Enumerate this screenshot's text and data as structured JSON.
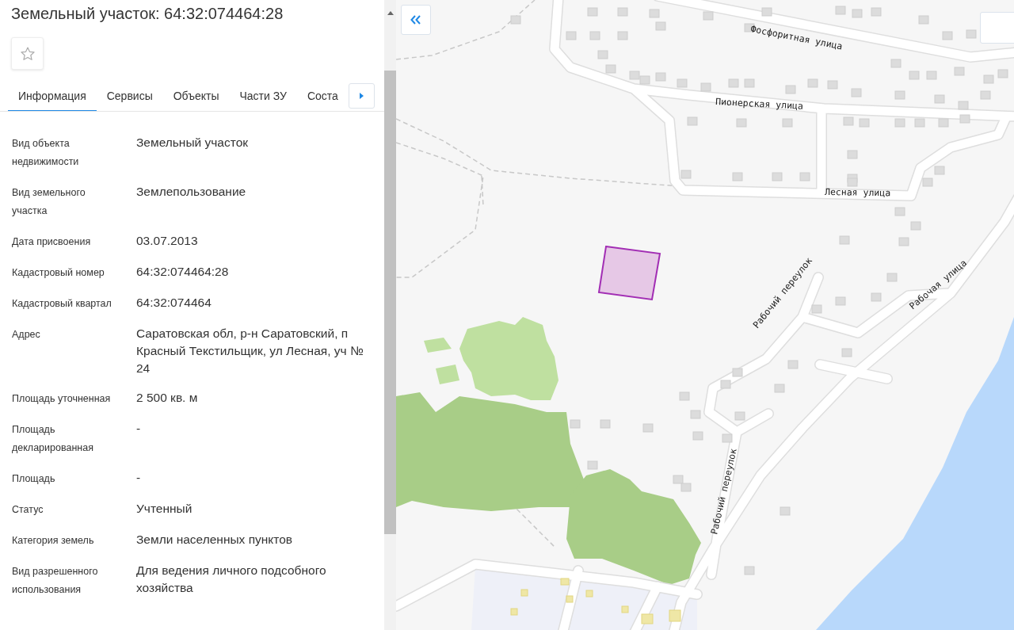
{
  "title": "Земельный участок: 64:32:074464:28",
  "favorite": {
    "selected": false
  },
  "tabs": [
    {
      "label": "Информация",
      "selected": true
    },
    {
      "label": "Сервисы",
      "selected": false
    },
    {
      "label": "Объекты",
      "selected": false
    },
    {
      "label": "Части ЗУ",
      "selected": false
    },
    {
      "label": "Соста",
      "selected": false
    }
  ],
  "fields": [
    {
      "label": "Вид объекта недвижимости",
      "value": "Земельный участок"
    },
    {
      "label": "Вид земельного участка",
      "value": "Землепользование"
    },
    {
      "label": "Дата присвоения",
      "value": "03.07.2013"
    },
    {
      "label": "Кадастровый номер",
      "value": "64:32:074464:28"
    },
    {
      "label": "Кадастровый квартал",
      "value": "64:32:074464"
    },
    {
      "label": "Адрес",
      "value": "Саратовская обл, р-н Саратовский, п Красный Текстильщик, ул Лесная, уч № 24"
    },
    {
      "label": "Площадь уточненная",
      "value": "2 500 кв. м"
    },
    {
      "label": "Площадь декларированная",
      "value": "-"
    },
    {
      "label": "Площадь",
      "value": "-"
    },
    {
      "label": "Статус",
      "value": "Учтенный"
    },
    {
      "label": "Категория земель",
      "value": "Земли населенных пунктов"
    },
    {
      "label": "Вид разрешенного использования",
      "value": "Для ведения личного подсобного хозяйства"
    }
  ],
  "map": {
    "streets": [
      {
        "label": "Фосфоритная улица"
      },
      {
        "label": "Пионерская улица"
      },
      {
        "label": "Лесная улица"
      },
      {
        "label": "Рабочий переулок"
      },
      {
        "label": "Рабочий переулок"
      },
      {
        "label": "Рабочая улица"
      }
    ]
  }
}
